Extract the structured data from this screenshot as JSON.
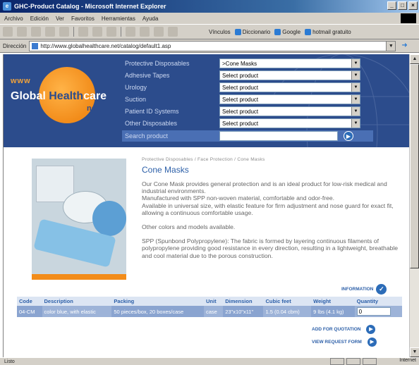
{
  "window": {
    "title": "GHC-Product Catalog - Microsoft Internet Explorer"
  },
  "menu": [
    "Archivo",
    "Edición",
    "Ver",
    "Favoritos",
    "Herramientas",
    "Ayuda"
  ],
  "toolbar": {
    "links_label": "Vínculos",
    "links": [
      "Diccionario",
      "Google",
      "hotmail gratuito"
    ]
  },
  "address": {
    "label": "Dirección",
    "url": "http://www.globalhealthcare.net/catalog/default1.asp"
  },
  "status": {
    "text": "Listo",
    "zone": "Internet"
  },
  "logo": {
    "www": "www",
    "global": "Global",
    "health": "Health",
    "care": "care",
    "net": "net"
  },
  "categories": [
    {
      "label": "Protective Disposables",
      "selected": ">Cone Masks"
    },
    {
      "label": "Adhesive Tapes",
      "selected": "Select product"
    },
    {
      "label": "Urology",
      "selected": "Select product"
    },
    {
      "label": "Suction",
      "selected": "Select product"
    },
    {
      "label": "Patient ID Systems",
      "selected": "Select product"
    },
    {
      "label": "Other Disposables",
      "selected": "Select product"
    }
  ],
  "search": {
    "label": "Search product",
    "value": ""
  },
  "product": {
    "breadcrumb": "Protective Disposables / Face Protection / Cone Masks",
    "title": "Cone Masks",
    "desc1": "Our Cone Mask provides general protection and is an ideal product for low-risk medical and industrial environments.",
    "desc2": "Manufactured with SPP non-woven material, comfortable and odor-free.",
    "desc3": "Available in universal size, with elastic feature for firm adjustment and nose guard for exact fit, allowing a continuous comfortable usage.",
    "desc4": "Other colors and models available.",
    "desc5": "SPP (Spunbond Polypropylene): The fabric is formed by layering continuous filaments of polypropylene providing good resistance in every direction, resulting in a lightweight, breathable and cool material due to the porous construction."
  },
  "information_label": "INFORMATION",
  "table": {
    "headers": [
      "Code",
      "Description",
      "Packing",
      "Unit",
      "Dimension",
      "Cubic feet",
      "Weight",
      "Quantity"
    ],
    "row": {
      "code": "04-CM",
      "description": "color blue, with elastic",
      "packing": "50 pieces/box, 20 boxes/case",
      "unit": "case",
      "dimension": "23\"x10\"x11\"",
      "cubic": "1.5 (0.04 cbm)",
      "weight": "9 lbs (4.1 kg)",
      "quantity": "0"
    }
  },
  "actions": {
    "quotation": "ADD FOR QUOTATION",
    "request": "VIEW REQUEST FORM"
  },
  "colors": {
    "header_blue": "#2c4c8c",
    "logo_orange": "#f28c1a",
    "link_blue": "#2c5fa8"
  }
}
